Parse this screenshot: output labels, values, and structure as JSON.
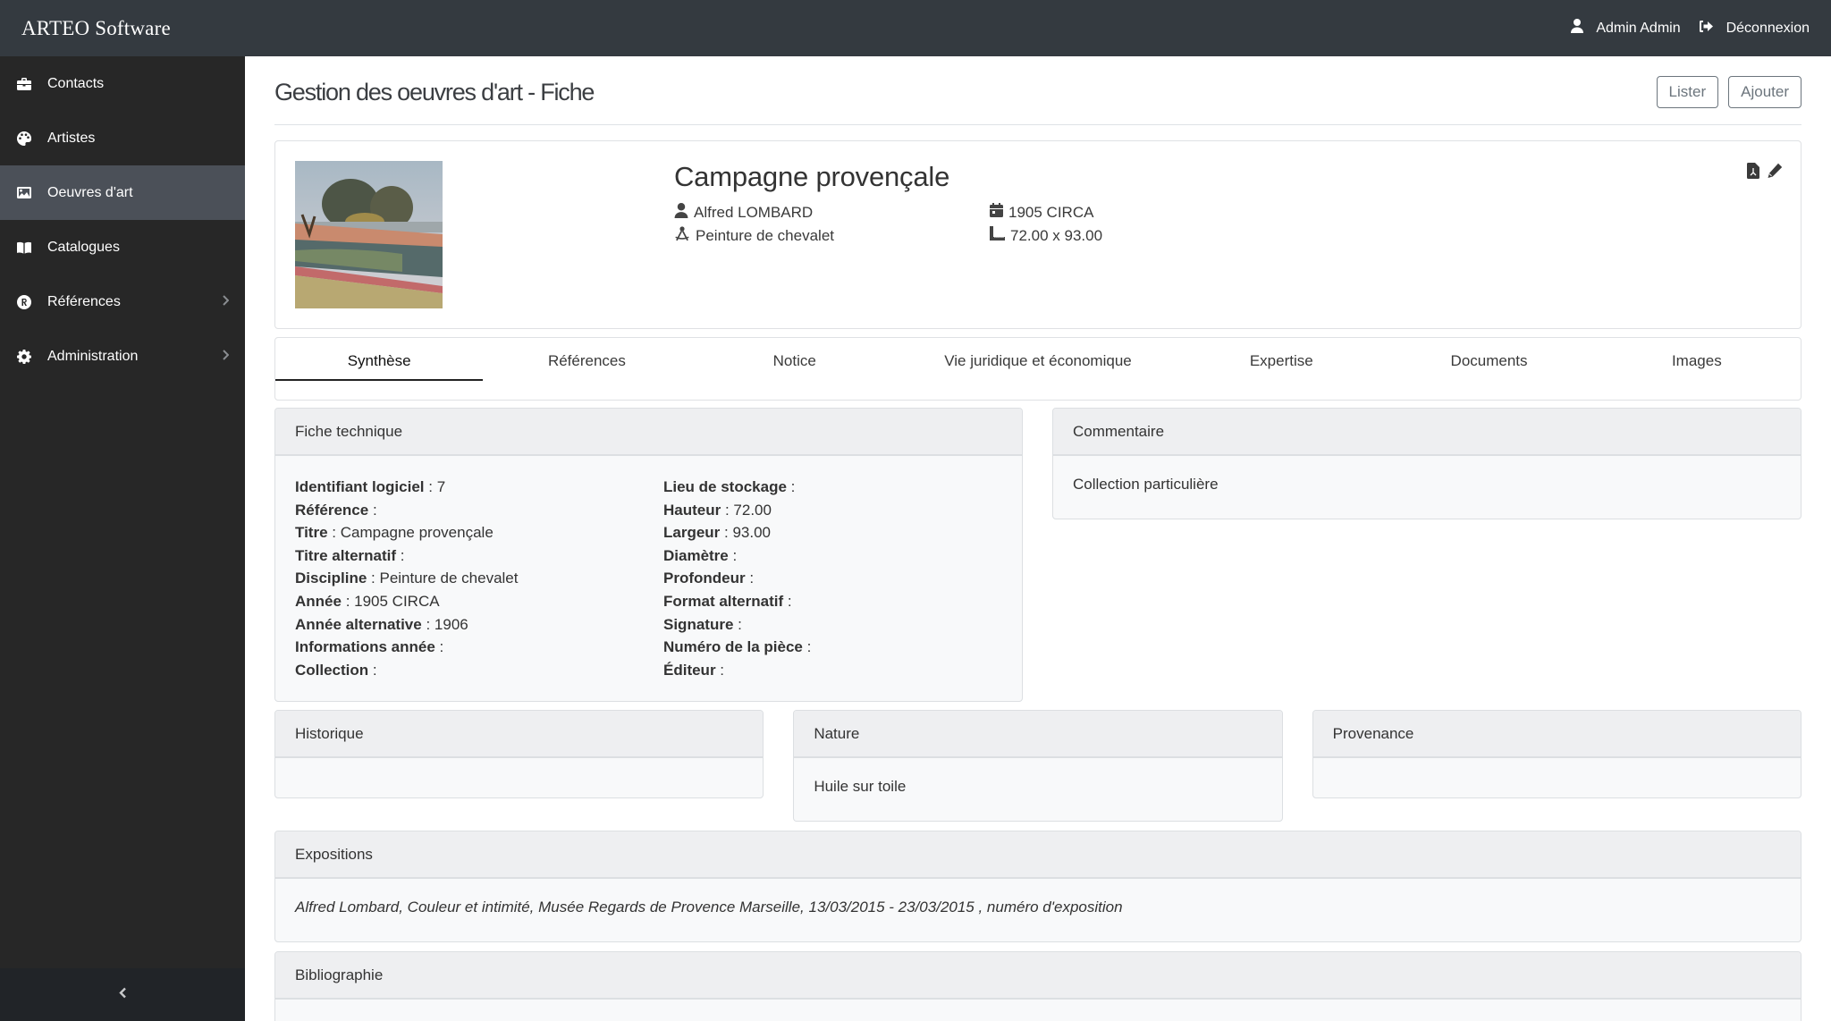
{
  "app": {
    "brand": "ARTEO Software",
    "user_name": "Admin Admin",
    "logout_label": "Déconnexion"
  },
  "sidebar": {
    "items": [
      {
        "label": "Contacts",
        "icon": "briefcase-icon",
        "active": false,
        "has_submenu": false
      },
      {
        "label": "Artistes",
        "icon": "palette-icon",
        "active": false,
        "has_submenu": false
      },
      {
        "label": "Oeuvres d'art",
        "icon": "image-icon",
        "active": true,
        "has_submenu": false
      },
      {
        "label": "Catalogues",
        "icon": "book-open-icon",
        "active": false,
        "has_submenu": false
      },
      {
        "label": "Références",
        "icon": "registered-icon",
        "active": false,
        "has_submenu": true
      },
      {
        "label": "Administration",
        "icon": "gear-icon",
        "active": false,
        "has_submenu": true
      }
    ],
    "collapse_icon": "chevron-left-icon"
  },
  "page": {
    "title": "Gestion des oeuvres d'art - Fiche",
    "list_button": "Lister",
    "add_button": "Ajouter"
  },
  "artwork": {
    "title": "Campagne provençale",
    "artist": "Alfred LOMBARD",
    "discipline": "Peinture de chevalet",
    "year": "1905 CIRCA",
    "dimensions": "72.00 x 93.00",
    "actions": [
      "pdf-export-icon",
      "edit-pencil-icon"
    ]
  },
  "tabs": [
    {
      "label": "Synthèse",
      "active": true
    },
    {
      "label": "Références",
      "active": false
    },
    {
      "label": "Notice",
      "active": false
    },
    {
      "label": "Vie juridique et économique",
      "active": false
    },
    {
      "label": "Expertise",
      "active": false
    },
    {
      "label": "Documents",
      "active": false
    },
    {
      "label": "Images",
      "active": false
    }
  ],
  "fiche_technique": {
    "heading": "Fiche technique",
    "left": [
      {
        "label": "Identifiant logiciel",
        "value": "7"
      },
      {
        "label": "Référence",
        "value": ""
      },
      {
        "label": "Titre",
        "value": "Campagne provençale"
      },
      {
        "label": "Titre alternatif",
        "value": ""
      },
      {
        "label": "Discipline",
        "value": "Peinture de chevalet"
      },
      {
        "label": "Année",
        "value": "1905 CIRCA"
      },
      {
        "label": "Année alternative",
        "value": "1906"
      },
      {
        "label": "Informations année",
        "value": ""
      },
      {
        "label": "Collection",
        "value": ""
      }
    ],
    "right": [
      {
        "label": "Lieu de stockage",
        "value": ""
      },
      {
        "label": "Hauteur",
        "value": "72.00"
      },
      {
        "label": "Largeur",
        "value": "93.00"
      },
      {
        "label": "Diamètre",
        "value": ""
      },
      {
        "label": "Profondeur",
        "value": ""
      },
      {
        "label": "Format alternatif",
        "value": ""
      },
      {
        "label": "Signature",
        "value": ""
      },
      {
        "label": "Numéro de la pièce",
        "value": ""
      },
      {
        "label": "Éditeur",
        "value": ""
      }
    ]
  },
  "commentaire": {
    "heading": "Commentaire",
    "body": "Collection particulière"
  },
  "historique": {
    "heading": "Historique",
    "body": ""
  },
  "nature": {
    "heading": "Nature",
    "body": "Huile sur toile"
  },
  "provenance": {
    "heading": "Provenance",
    "body": ""
  },
  "expositions": {
    "heading": "Expositions",
    "body": "Alfred Lombard, Couleur et intimité, Musée Regards de Provence Marseille, 13/03/2015 - 23/03/2015 , numéro d'exposition"
  },
  "bibliographie": {
    "heading": "Bibliographie",
    "body": ""
  },
  "colors": {
    "topbar": "#343a40",
    "sidebar": "#272727",
    "sidebar_active": "#4b5058",
    "panel_header": "#eeeff1",
    "panel_body": "#f8f9fa"
  }
}
